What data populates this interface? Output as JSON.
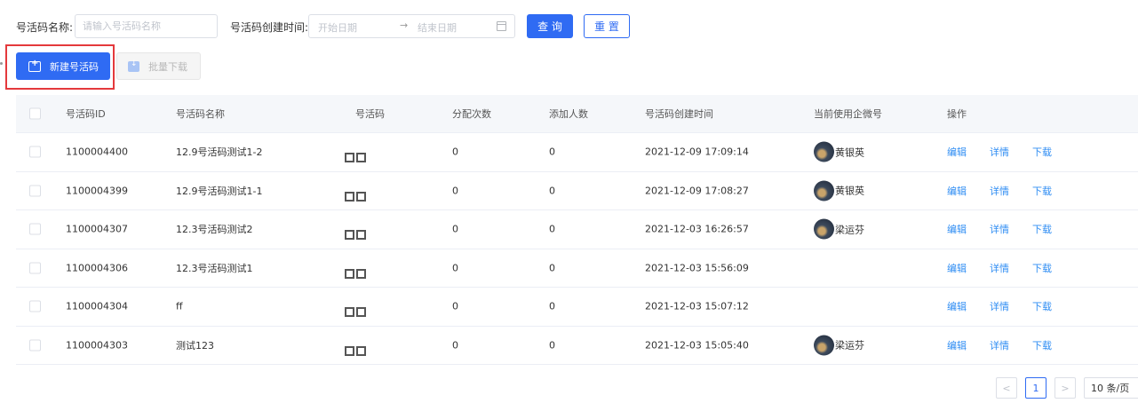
{
  "filters": {
    "name_label": "号活码名称:",
    "name_placeholder": "请输入号活码名称",
    "time_label": "号活码创建时间:",
    "date_start_placeholder": "开始日期",
    "date_separator": "→",
    "date_end_placeholder": "结束日期",
    "query_label": "查 询",
    "reset_label": "重 置"
  },
  "toolbar": {
    "new_label": "新建号活码",
    "download_label": "批量下载"
  },
  "table": {
    "headers": [
      "号活码ID",
      "号活码名称",
      "号活码",
      "分配次数",
      "添加人数",
      "号活码创建时间",
      "当前使用企微号",
      "操作"
    ],
    "rows": [
      {
        "id": "1100004400",
        "name": "12.9号活码测试1-2",
        "alloc": "0",
        "added": "0",
        "time": "2021-12-09 17:09:14",
        "user": "黄银英"
      },
      {
        "id": "1100004399",
        "name": "12.9号活码测试1-1",
        "alloc": "0",
        "added": "0",
        "time": "2021-12-09 17:08:27",
        "user": "黄银英"
      },
      {
        "id": "1100004307",
        "name": "12.3号活码测试2",
        "alloc": "0",
        "added": "0",
        "time": "2021-12-03 16:26:57",
        "user": "梁运芬"
      },
      {
        "id": "1100004306",
        "name": "12.3号活码测试1",
        "alloc": "0",
        "added": "0",
        "time": "2021-12-03 15:56:09",
        "user": ""
      },
      {
        "id": "1100004304",
        "name": "ff",
        "alloc": "0",
        "added": "0",
        "time": "2021-12-03 15:07:12",
        "user": ""
      },
      {
        "id": "1100004303",
        "name": "测试123",
        "alloc": "0",
        "added": "0",
        "time": "2021-12-03 15:05:40",
        "user": "梁运芬"
      }
    ],
    "ops": {
      "edit": "编辑",
      "detail": "详情",
      "download": "下载"
    }
  },
  "pager": {
    "prev": "<",
    "current": "1",
    "next": ">",
    "page_size": "10 条/页"
  }
}
